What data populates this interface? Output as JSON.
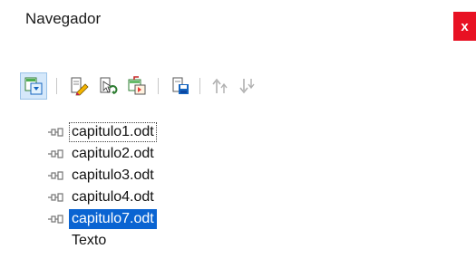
{
  "window": {
    "title": "Navegador",
    "close_label": "x",
    "accent_close": "#e81123"
  },
  "toolbar": {
    "buttons": [
      {
        "icon": "toggle-view-icon",
        "state": "active"
      },
      {
        "icon": "edit-icon",
        "state": "normal"
      },
      {
        "icon": "update-icon",
        "state": "normal"
      },
      {
        "icon": "insert-icon",
        "state": "normal"
      },
      {
        "icon": "save-as-icon",
        "state": "normal"
      },
      {
        "icon": "move-up-icon",
        "state": "disabled"
      },
      {
        "icon": "move-down-icon",
        "state": "disabled"
      }
    ]
  },
  "tree": {
    "items": [
      {
        "label": "capitulo1.odt",
        "icon": "link-icon"
      },
      {
        "label": "capitulo2.odt",
        "icon": "link-icon"
      },
      {
        "label": "capitulo3.odt",
        "icon": "link-icon"
      },
      {
        "label": "capitulo4.odt",
        "icon": "link-icon"
      },
      {
        "label": "capitulo7.odt",
        "icon": "link-icon"
      },
      {
        "label": "Texto",
        "icon": ""
      }
    ],
    "selected_index": 4,
    "focused_index": 0,
    "selection_color": "#0a64d2"
  }
}
